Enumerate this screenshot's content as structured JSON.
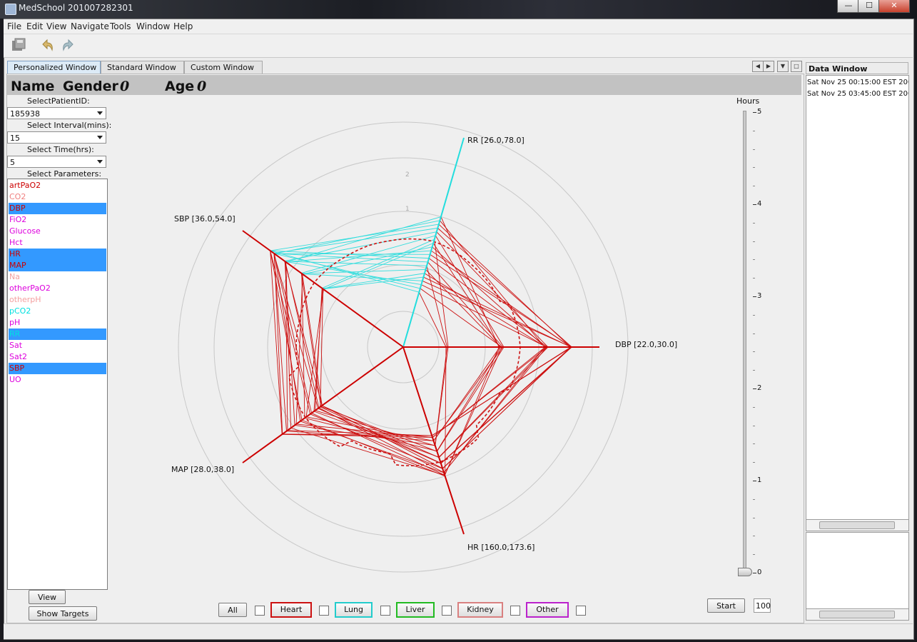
{
  "window": {
    "title": "MedSchool 201007282301",
    "minimize": "—",
    "maximize": "☐",
    "close": "✕"
  },
  "menu": [
    "File",
    "Edit",
    "View",
    "Navigate",
    "Tools",
    "Window",
    "Help"
  ],
  "toolbar": {
    "icons": [
      "save-all-icon",
      "undo-icon",
      "redo-icon"
    ]
  },
  "tabs": [
    "Personalized Window",
    "Standard Window",
    "Custom Window"
  ],
  "header": {
    "name_label": "Name",
    "gender_label": "Gender",
    "gender_value": "0",
    "age_label": "Age",
    "age_value": "0"
  },
  "controls": {
    "patient_label": "SelectPatientID:",
    "patient_value": "185938",
    "interval_label": "Select Interval(mins):",
    "interval_value": "15",
    "time_label": "Select Time(hrs):",
    "time_value": "5",
    "params_label": "Select Parameters:"
  },
  "parameters": [
    {
      "name": "artPaO2",
      "color": "#cc0000",
      "selected": false
    },
    {
      "name": "CO2",
      "color": "#f08080",
      "selected": false
    },
    {
      "name": "DBP",
      "color": "#cc0000",
      "selected": true
    },
    {
      "name": "FiO2",
      "color": "#dd00dd",
      "selected": false
    },
    {
      "name": "Glucose",
      "color": "#dd00dd",
      "selected": false
    },
    {
      "name": "Hct",
      "color": "#dd00dd",
      "selected": false
    },
    {
      "name": "HR",
      "color": "#cc0000",
      "selected": true
    },
    {
      "name": "MAP",
      "color": "#cc0000",
      "selected": true
    },
    {
      "name": "Na",
      "color": "#f4a0a0",
      "selected": false
    },
    {
      "name": "otherPaO2",
      "color": "#dd00dd",
      "selected": false
    },
    {
      "name": "otherpH",
      "color": "#f4a0a0",
      "selected": false
    },
    {
      "name": "pCO2",
      "color": "#00e0e0",
      "selected": false
    },
    {
      "name": "pH",
      "color": "#dd00dd",
      "selected": false
    },
    {
      "name": "RR",
      "color": "#00e0e0",
      "selected": true
    },
    {
      "name": "Sat",
      "color": "#dd00dd",
      "selected": false
    },
    {
      "name": "Sat2",
      "color": "#dd00dd",
      "selected": false
    },
    {
      "name": "SBP",
      "color": "#cc0000",
      "selected": true
    },
    {
      "name": "UO",
      "color": "#dd00dd",
      "selected": false
    }
  ],
  "buttons": {
    "view": "View",
    "show_targets": "Show Targets",
    "all": "All",
    "start": "Start",
    "speed_value": "100"
  },
  "categories": [
    {
      "label": "Heart",
      "color": "#cc1111"
    },
    {
      "label": "Lung",
      "color": "#22cccc"
    },
    {
      "label": "Liver",
      "color": "#22bb22"
    },
    {
      "label": "Kidney",
      "color": "#d98080"
    },
    {
      "label": "Other",
      "color": "#bb22cc"
    }
  ],
  "chart_data": {
    "type": "radar",
    "axes": [
      {
        "label": "RR [26.0,78.0]",
        "color": "#22dddd"
      },
      {
        "label": "DBP [22.0,30.0]",
        "color": "#cc0000"
      },
      {
        "label": "HR [160.0,173.6]",
        "color": "#cc0000"
      },
      {
        "label": "MAP [28.0,38.0]",
        "color": "#cc0000"
      },
      {
        "label": "SBP [36.0,54.0]",
        "color": "#cc0000"
      }
    ],
    "ring_labels": [
      "1",
      "2"
    ],
    "grid": true
  },
  "timeline": {
    "title": "Hours",
    "ticks": [
      "5",
      "4",
      "3",
      "2",
      "1",
      "0"
    ],
    "value": 0
  },
  "data_window": {
    "title": "Data Window",
    "rows": [
      "Sat Nov 25 00:15:00 EST 200",
      "Sat Nov 25 03:45:00 EST 200"
    ]
  }
}
